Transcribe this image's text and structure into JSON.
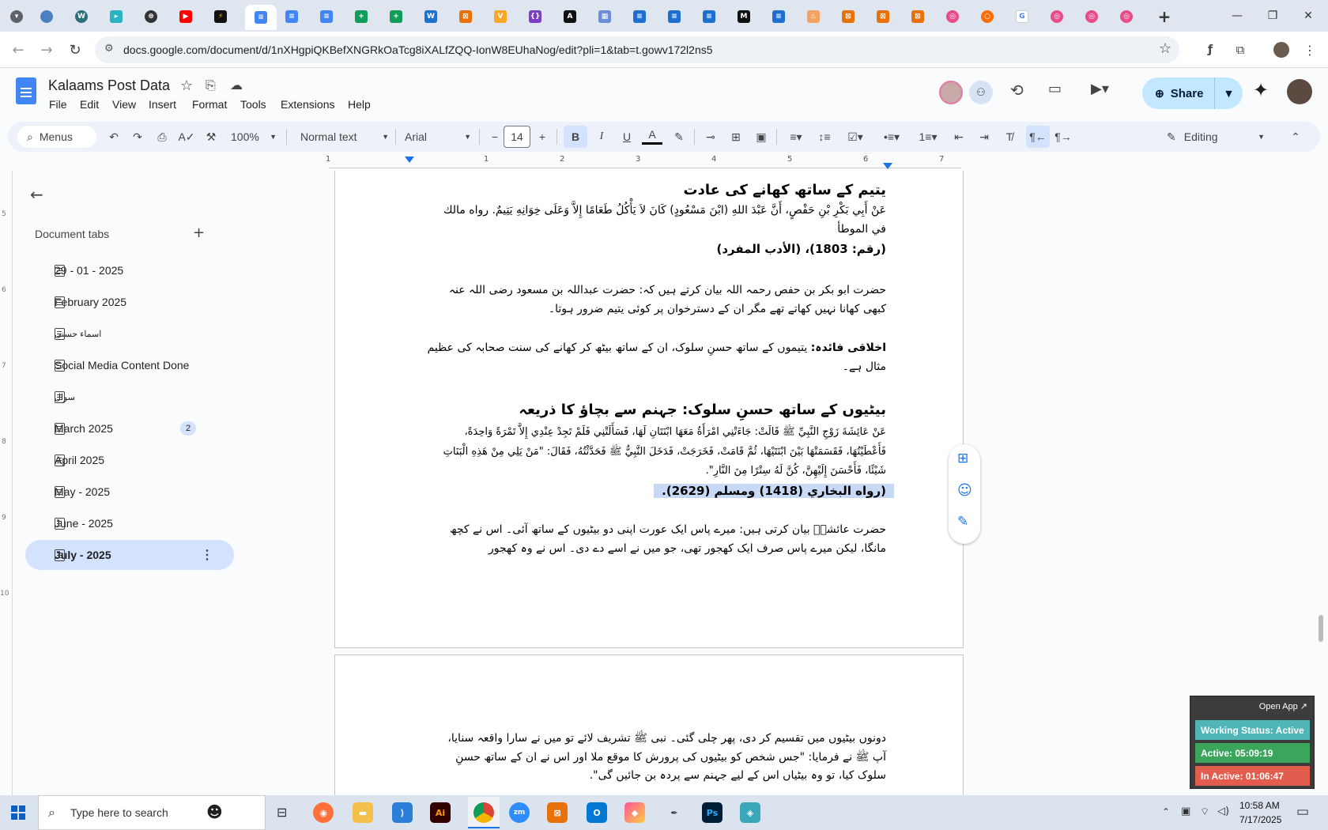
{
  "browser": {
    "url": "docs.google.com/document/d/1nXHgpiQKBefXNGRkOaTcg8iXALfZQQ-IonW8EUhaNog/edit?pli=1&tab=t.gowv172l2ns5",
    "new_tab": "+",
    "tabs": [
      "doc",
      "doc",
      "sheet",
      "sheet",
      "word",
      "app",
      "app",
      "code",
      "code",
      "doc",
      "doc",
      "doc",
      "doc"
    ]
  },
  "docs": {
    "title": "Kalaams Post Data",
    "menus": [
      "File",
      "Edit",
      "View",
      "Insert",
      "Format",
      "Tools",
      "Extensions",
      "Help"
    ],
    "share_label": "Share"
  },
  "toolbar": {
    "search_label": "Menus",
    "zoom": "100%",
    "style": "Normal text",
    "font": "Arial",
    "size": "14",
    "mode": "Editing",
    "bold": "B",
    "italic": "I",
    "underline": "U",
    "minus": "−",
    "plus": "+"
  },
  "ruler": {
    "ticks": [
      "1",
      "1",
      "2",
      "3",
      "4",
      "5",
      "6",
      "7"
    ]
  },
  "left_ruler": {
    "ticks": [
      "5",
      "6",
      "7",
      "8",
      "9",
      "10"
    ]
  },
  "sidebar": {
    "heading": "Document tabs",
    "add": "+",
    "items": [
      {
        "label": "29 - 01 - 2025"
      },
      {
        "label": "February 2025"
      },
      {
        "label": "اسماء حسنی"
      },
      {
        "label": "Social Media Content Done"
      },
      {
        "label": "سوال"
      },
      {
        "label": "March 2025",
        "badge": "2"
      },
      {
        "label": "April 2025"
      },
      {
        "label": "May - 2025"
      },
      {
        "label": "June - 2025"
      },
      {
        "label": "July - 2025"
      }
    ]
  },
  "document": {
    "h1": "یتیم کے ساتھ کھانے کی عادت",
    "arabic1_l1": "عَنْ أَبِي بَكْرِ بْنِ حَفْصٍ، أَنَّ عَبْدَ اللهِ (ابْنَ مَسْعُودٍ) كَانَ لاَ يَأْكُلُ طَعَامًا إِلاَّ وَعَلَى خِوَانِهِ يَتِيمٌ. رواه مالك",
    "arabic1_l2": "في الموطأ",
    "ref1": "(رقم: 1803)، (الأدب المفرد)",
    "urdu1_l1": "حضرت ابو بکر بن حفص رحمہ اللہ بیان کرتے ہیں کہ: حضرت عبداللہ بن مسعود رضی اللہ عنہ",
    "urdu1_l2": "کبھی کھانا نہیں کھاتے تھے مگر ان کے دسترخوان پر کوئی یتیم ضرور ہوتا۔",
    "lesson_label": "اخلاقی فائدہ:",
    "lesson_l1": " یتیموں کے ساتھ حسنِ سلوک، ان کے ساتھ بیٹھ کر کھانے کی سنت صحابہ کی عظیم",
    "lesson_l2": "مثال ہے۔",
    "h2": "بیٹیوں کے ساتھ حسنِ سلوک: جہنم سے بچاؤ کا ذریعہ",
    "arabic2_l1": "عَنْ عَائِشَةَ زَوْجِ النَّبِيِّ ﷺ قَالَتْ: جَاءَتْنِي امْرَأَةٌ مَعَهَا ابْنَتَانِ لَهَا، فَسَأَلَتْنِي فَلَمْ تَجِدْ عِنْدِي إِلاَّ تَمْرَةً وَاحِدَةً،",
    "arabic2_l2": "فَأَعْطَيْتُهَا، فَقَسَمَتْهَا بَيْنَ ابْنَتَيْهَا، ثُمَّ قَامَتْ، فَخَرَجَتْ، فَدَخَلَ النَّبِيُّ ﷺ فَحَدَّثْتُهُ، فَقَالَ: \"مَنْ يَلِي مِنْ هَذِهِ الْبَنَاتِ",
    "arabic2_l3": "شَيْئًا، فَأَحْسَنَ إِلَيْهِنَّ، كُنَّ لَهُ سِتْرًا مِنَ النَّارِ\".",
    "ref2": "(رواه البخاري (1418) ومسلم (2629).",
    "urdu2_l1": "حضرت عائشہؓ بیان کرتی ہیں: میرے پاس ایک عورت اپنی دو بیٹیوں کے ساتھ آئی۔ اس نے کچھ",
    "urdu2_l2": "مانگا، لیکن میرے پاس صرف ایک کھجور تھی، جو میں نے اسے دے دی۔ اس نے وہ کھجور",
    "page2_l1": "دونوں بیٹیوں میں تقسیم کر دی، پھر چلی گئی۔ نبی ﷺ تشریف لائے تو میں نے سارا واقعہ سنایا،",
    "page2_l2": "آپ ﷺ نے فرمایا: \"جس شخص کو بیٹیوں کی پرورش کا موقع ملا اور اس نے ان کے ساتھ حسنِ",
    "page2_l3": "سلوک کیا، تو وہ بیٹیاں اس کے لیے جہنم سے پردہ بن جائیں گی\"."
  },
  "status_widget": {
    "open_app": "Open App ↗",
    "working": "Working Status: Active",
    "active": "Active: 05:09:19",
    "inactive": "In Active: 01:06:47",
    "colors": {
      "working": "#4fb5b7",
      "active": "#3ba55c",
      "inactive": "#e35d4f"
    }
  },
  "taskbar": {
    "search_placeholder": "Type here to search",
    "time": "10:58 AM",
    "date": "7/17/2025"
  }
}
